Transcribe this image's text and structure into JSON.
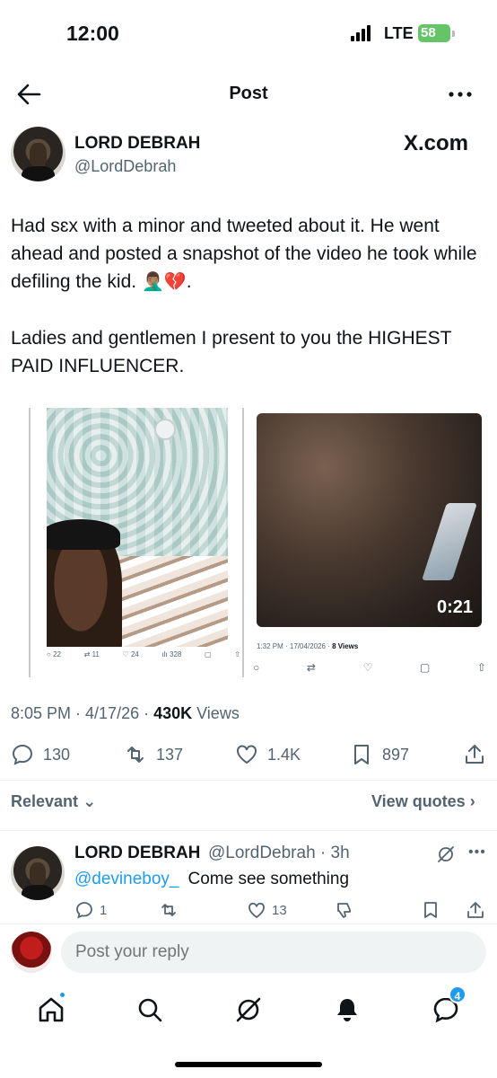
{
  "status_bar": {
    "time": "12:00",
    "network": "LTE",
    "battery": "58"
  },
  "header": {
    "title": "Post"
  },
  "post": {
    "author_name": "LORD DEBRAH",
    "author_handle": "@LordDebrah",
    "source": "X.com",
    "text_line1": "Had sɛx with a minor and tweeted about it. He went ahead and posted a snapshot of the video he took while defiling the kid.",
    "text_emoji": "🤦🏽‍♂️💔",
    "text_end": ".",
    "text_line2": "Ladies and gentlemen I present to you the HIGHEST PAID INFLUENCER.",
    "media": {
      "left_counts": {
        "replies": "22",
        "reposts": "11",
        "likes": "24",
        "views": "328"
      },
      "right_meta_time": "1:32 PM · 17/04/2026 · ",
      "right_meta_views": "8 Views",
      "video_duration": "0:21"
    },
    "time": "8:05 PM · 4/17/26 · ",
    "views_count": "430K",
    "views_label": " Views",
    "stats": {
      "replies": "130",
      "reposts": "137",
      "likes": "1.4K",
      "bookmarks": "897"
    }
  },
  "sort": {
    "label": "Relevant",
    "view_quotes": "View quotes"
  },
  "reply": {
    "author_name": "LORD DEBRAH",
    "handle_time": "@LordDebrah · 3h",
    "mention": "@devineboy_",
    "text": "Come see something",
    "replies": "1",
    "likes": "13"
  },
  "composer": {
    "placeholder": "Post your reply"
  },
  "nav": {
    "messages_badge": "4"
  }
}
